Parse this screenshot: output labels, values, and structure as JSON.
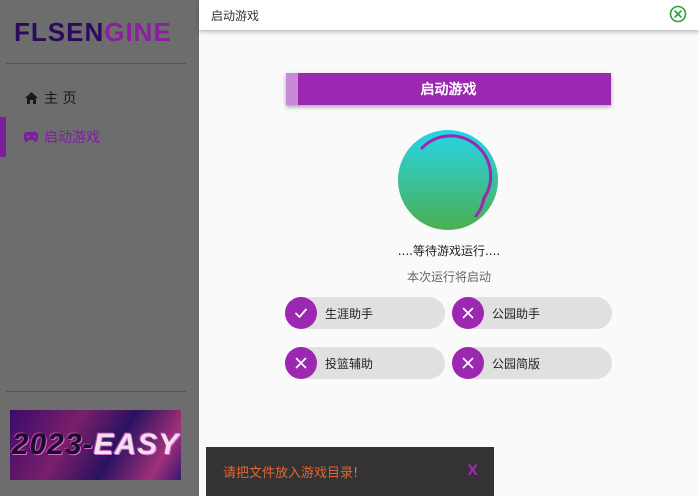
{
  "app": {
    "logo_prefix": "FLSEN",
    "logo_suffix": "GINE",
    "window_title": "启动游戏"
  },
  "sidebar": {
    "items": [
      {
        "label": "主 页",
        "icon": "home-icon"
      },
      {
        "label": "启动游戏",
        "icon": "gamepad-icon"
      }
    ],
    "banner_prefix": "2023-",
    "banner_highlight": "EASY"
  },
  "main": {
    "launch_label": "启动游戏",
    "status_text": "....等待游戏运行....",
    "sub_status": "本次运行将启动",
    "modules": [
      {
        "label": "生涯助手",
        "state": "check-icon"
      },
      {
        "label": "公园助手",
        "state": "close-icon"
      },
      {
        "label": "投篮辅助",
        "state": "close-icon"
      },
      {
        "label": "公园简版",
        "state": "close-icon"
      }
    ]
  },
  "snackbar": {
    "message": "请把文件放入游戏目录!",
    "close_label": "X"
  },
  "colors": {
    "accent": "#9c27b0",
    "sidebar_bg": "#6d6d6d",
    "snackbar_bg": "#333333",
    "snackbar_text": "#e8632f",
    "close_green": "#2e9e3e"
  }
}
